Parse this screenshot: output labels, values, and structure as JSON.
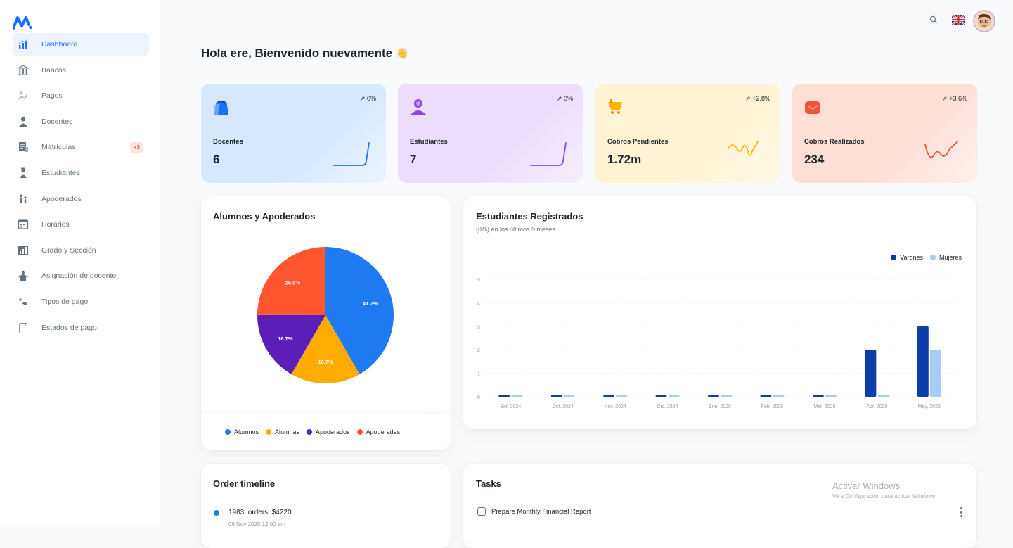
{
  "sidebar": {
    "items": [
      {
        "label": "Dashboard",
        "icon": "dashboard-icon",
        "active": true
      },
      {
        "label": "Bancos",
        "icon": "bank-icon"
      },
      {
        "label": "Pagos",
        "icon": "payments-icon"
      },
      {
        "label": "Docentes",
        "icon": "teacher-icon"
      },
      {
        "label": "Matrículas",
        "icon": "enrollment-icon",
        "badge": "+3"
      },
      {
        "label": "Estudiantes",
        "icon": "students-icon"
      },
      {
        "label": "Apoderados",
        "icon": "guardians-icon"
      },
      {
        "label": "Horarios",
        "icon": "schedule-icon"
      },
      {
        "label": "Grado y Sección",
        "icon": "grade-icon"
      },
      {
        "label": "Asignación de docente",
        "icon": "assignment-icon"
      },
      {
        "label": "Tipos de pago",
        "icon": "payment-types-icon"
      },
      {
        "label": "Estados de pago",
        "icon": "payment-status-icon"
      }
    ]
  },
  "topbar": {
    "search_icon": "search-icon",
    "language_icon": "uk-flag-icon",
    "avatar_icon": "avatar-icon"
  },
  "greeting": {
    "text": "Hola ere, Bienvenido nuevamente",
    "emoji": "👋"
  },
  "stats": [
    {
      "label": "Docentes",
      "value": "6",
      "trend": "0%",
      "bg": "#D6E8FD",
      "accent": "#1E6FF5",
      "icon": "bag-icon"
    },
    {
      "label": "Estudiantes",
      "value": "7",
      "trend": "0%",
      "bg": "#EBDDFB",
      "accent": "#8E44F0",
      "icon": "user-icon"
    },
    {
      "label": "Cobros Pendientes",
      "value": "1.72m",
      "trend": "+2.8%",
      "bg": "#FEF3D2",
      "accent": "#FFB400",
      "icon": "cart-icon"
    },
    {
      "label": "Cobros Realizados",
      "value": "234",
      "trend": "+3.6%",
      "bg": "#FDDFD6",
      "accent": "#F0533A",
      "icon": "mail-icon"
    }
  ],
  "pie_panel": {
    "title": "Alumnos y Apoderados",
    "legend": [
      "Alumnos",
      "Alumnas",
      "Apoderados",
      "Apoderadas"
    ]
  },
  "bar_panel": {
    "title": "Estudiantes Registrados",
    "subtitle": "(0%) en los últimos 9 meses",
    "legend": [
      "Varones",
      "Mujeres"
    ]
  },
  "chart_data": [
    {
      "type": "pie",
      "title": "Alumnos y Apoderados",
      "categories": [
        "Alumnos",
        "Alumnas",
        "Apoderados",
        "Apoderadas"
      ],
      "values": [
        41.7,
        16.7,
        16.7,
        25.0
      ],
      "labels": [
        "41.7%",
        "16.7%",
        "16.7%",
        "25.0%"
      ],
      "colors": [
        "#1E7BF2",
        "#FFAB00",
        "#5C1EB8",
        "#FF5630"
      ]
    },
    {
      "type": "bar",
      "title": "Estudiantes Registrados",
      "categories": [
        "Set. 2024",
        "Oct. 2024",
        "Nov. 2024",
        "Dic. 2024",
        "Ene. 2025",
        "Feb. 2025",
        "Mar. 2025",
        "Abr. 2025",
        "May. 2025"
      ],
      "series": [
        {
          "name": "Varones",
          "values": [
            0,
            0,
            0,
            0,
            0,
            0,
            0,
            2,
            3
          ],
          "color": "#0B3EA8"
        },
        {
          "name": "Mujeres",
          "values": [
            0,
            0,
            0,
            0,
            0,
            0,
            0,
            0,
            2
          ],
          "color": "#A5CDF5"
        }
      ],
      "yticks": [
        "0",
        "1",
        "2",
        "3",
        "4",
        "5"
      ],
      "ylim": [
        0,
        5
      ],
      "grid": true,
      "legend_position": "top-right"
    }
  ],
  "timeline": {
    "title": "Order timeline",
    "items": [
      {
        "text": "1983, orders, $4220",
        "time": "06 Nov 2025 12:00 am"
      }
    ]
  },
  "tasks": {
    "title": "Tasks",
    "items": [
      {
        "text": "Prepare Monthly Financial Report"
      }
    ]
  },
  "watermark": {
    "line1": "Activar Windows",
    "line2": "Ve a Configuración para activar Windows."
  }
}
